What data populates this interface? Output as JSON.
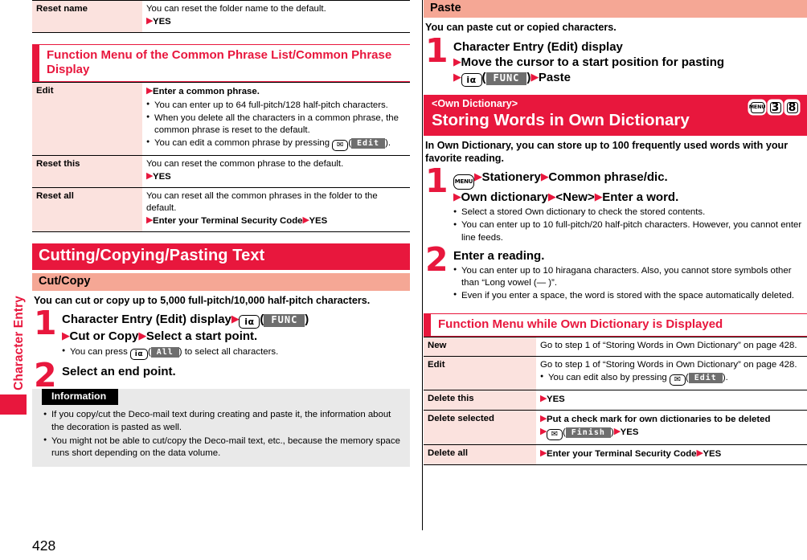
{
  "page_number": "428",
  "side_tab": {
    "label": "Character Entry"
  },
  "colors": {
    "brand_red": "#E8173D",
    "heading_pink": "#F5A795",
    "table_key_pink": "#FBE2DE",
    "info_gray": "#E9E9E9",
    "softkey_gray": "#6E6E6E"
  },
  "left_column": {
    "table_top": {
      "rows": [
        {
          "key": "Reset name",
          "lines": [
            "You can reset the folder name to the default.",
            "YES"
          ]
        }
      ]
    },
    "section_heading": "Function Menu of the Common Phrase List/Common Phrase Display",
    "table_function_menu": {
      "rows": [
        {
          "key": "Edit",
          "head": "Enter a common phrase.",
          "bullets": [
            "You can enter up to 64 full-pitch/128 half-pitch characters.",
            "When you delete all the characters in a common phrase, the common phrase is reset to the default.",
            "You can edit a common phrase by pressing (   )."
          ],
          "bullet3_pre": "You can edit a common phrase by pressing ",
          "bullet3_key": "mail-key",
          "bullet3_softkey": "Edit",
          "bullet3_post": "."
        },
        {
          "key": "Reset this",
          "lines": [
            "You can reset the common phrase to the default.",
            "YES"
          ]
        },
        {
          "key": "Reset all",
          "lines": [
            "You can reset all the common phrases in the folder to the default.",
            "Enter your Terminal Security Code",
            "YES"
          ]
        }
      ]
    },
    "chapter_heading": "Cutting/Copying/Pasting Text",
    "sub_heading": "Cut/Copy",
    "lead": "You can cut or copy up to 5,000 full-pitch/10,000 half-pitch characters.",
    "steps": [
      {
        "num": "1",
        "line1_a": "Character Entry (Edit) display",
        "line1_key": "i-alpha",
        "line1_softkey": "FUNC",
        "line2_a": "Cut or Copy",
        "line2_b": "Select a start point.",
        "bullets": [
          {
            "pre": "You can press ",
            "key": "i-alpha",
            "softkey": "All",
            "post": " to select all characters."
          }
        ]
      },
      {
        "num": "2",
        "line1_a": "Select an end point.",
        "bullets": []
      }
    ],
    "information": {
      "label": "Information",
      "bullets": [
        "If you copy/cut the Deco-mail text during creating and paste it, the information about the decoration is pasted as well.",
        "You might not be able to cut/copy the Deco-mail text, etc., because the memory space runs short depending on the data volume."
      ]
    }
  },
  "right_column": {
    "paste_heading": "Paste",
    "paste_lead": "You can paste cut or copied characters.",
    "paste_step": {
      "num": "1",
      "line1": "Character Entry (Edit) display",
      "line2": "Move the cursor to a start position for pasting",
      "line3_key": "i-alpha",
      "line3_softkey": "FUNC",
      "line3_after": "Paste"
    },
    "title_bar": {
      "sub": "<Own Dictionary>",
      "main": "Storing Words in Own Dictionary",
      "key_badges": [
        "MENU",
        "3",
        "8"
      ]
    },
    "lead": "In Own Dictionary, you can store up to 100 frequently used words with your favorite reading.",
    "steps": [
      {
        "num": "1",
        "key_glyph": "MENU",
        "line1_b": "Stationery",
        "line1_c": "Common phrase/dic.",
        "line2_a": "Own dictionary",
        "line2_b": "<New>",
        "line2_c": "Enter a word.",
        "bullets": [
          "Select a stored Own dictionary to check the stored contents.",
          "You can enter up to 10 full-pitch/20 half-pitch characters. However, you cannot enter line feeds."
        ]
      },
      {
        "num": "2",
        "line1_a": "Enter a reading.",
        "bullets": [
          "You can enter up to 10 hiragana characters. Also, you cannot store symbols other than “Long vowel (— )”.",
          "Even if you enter a space, the word is stored with the space automatically deleted."
        ]
      }
    ],
    "section_heading": "Function Menu while Own Dictionary is Displayed",
    "table_rows": [
      {
        "key": "New",
        "lines": [
          "Go to step 1 of “Storing Words in Own Dictionary” on page 428."
        ]
      },
      {
        "key": "Edit",
        "lines": [
          "Go to step 1 of “Storing Words in Own Dictionary” on page 428."
        ],
        "bullet_pre": "You can edit also by pressing ",
        "bullet_key": "mail-key",
        "bullet_softkey": "Edit",
        "bullet_post": "."
      },
      {
        "key": "Delete this",
        "lines": [
          "YES"
        ]
      },
      {
        "key": "Delete selected",
        "lines": [
          "Put a check mark for own dictionaries to be deleted"
        ],
        "line2_key": "mail-key",
        "line2_softkey": "Finish",
        "line2_after": "YES"
      },
      {
        "key": "Delete all",
        "lines": [
          "Enter your Terminal Security Code",
          "YES"
        ]
      }
    ]
  }
}
